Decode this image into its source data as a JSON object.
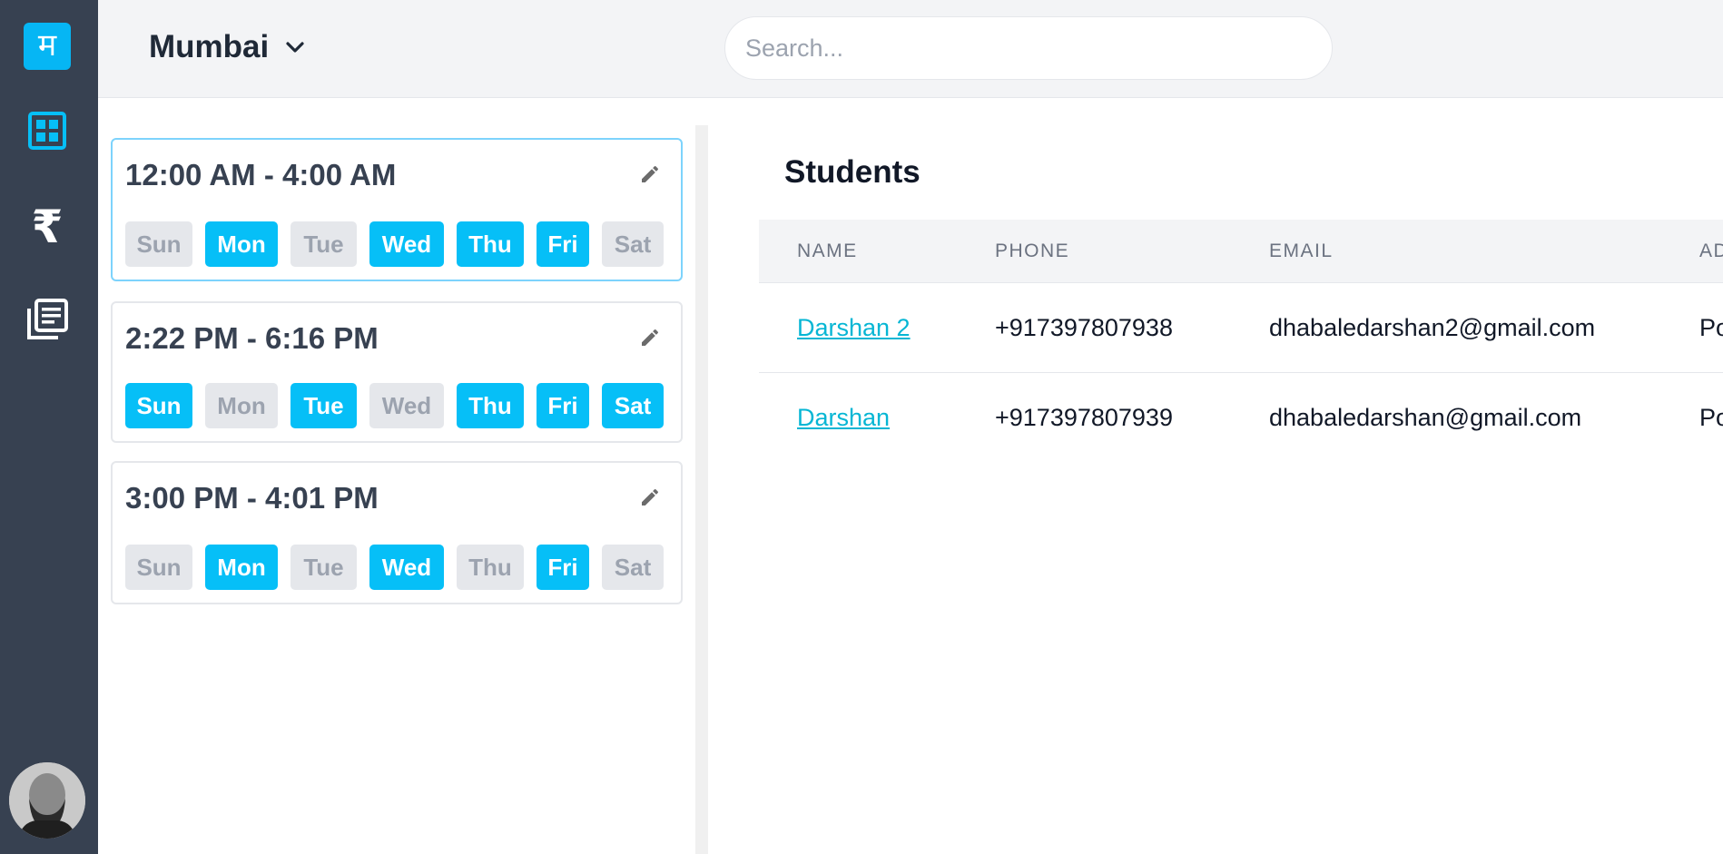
{
  "app": {
    "logo_glyph": "म",
    "accent_color": "#06bff7"
  },
  "sidebar": {
    "items": [
      {
        "icon": "dashboard-grid-icon"
      },
      {
        "icon": "rupee-icon",
        "glyph": "₹"
      },
      {
        "icon": "library-books-icon"
      }
    ],
    "avatar": "user-avatar"
  },
  "header": {
    "location": "Mumbai",
    "search_placeholder": "Search..."
  },
  "schedules": [
    {
      "time": "12:00 AM - 4:00 AM",
      "days": [
        {
          "label": "Sun",
          "active": false
        },
        {
          "label": "Mon",
          "active": true
        },
        {
          "label": "Tue",
          "active": false
        },
        {
          "label": "Wed",
          "active": true
        },
        {
          "label": "Thu",
          "active": true
        },
        {
          "label": "Fri",
          "active": true
        },
        {
          "label": "Sat",
          "active": false
        }
      ]
    },
    {
      "time": "2:22 PM - 6:16 PM",
      "days": [
        {
          "label": "Sun",
          "active": true
        },
        {
          "label": "Mon",
          "active": false
        },
        {
          "label": "Tue",
          "active": true
        },
        {
          "label": "Wed",
          "active": false
        },
        {
          "label": "Thu",
          "active": true
        },
        {
          "label": "Fri",
          "active": true
        },
        {
          "label": "Sat",
          "active": true
        }
      ]
    },
    {
      "time": "3:00 PM - 4:01 PM",
      "days": [
        {
          "label": "Sun",
          "active": false
        },
        {
          "label": "Mon",
          "active": true
        },
        {
          "label": "Tue",
          "active": false
        },
        {
          "label": "Wed",
          "active": true
        },
        {
          "label": "Thu",
          "active": false
        },
        {
          "label": "Fri",
          "active": true
        },
        {
          "label": "Sat",
          "active": false
        }
      ]
    }
  ],
  "students": {
    "title": "Students",
    "columns": [
      "NAME",
      "PHONE",
      "EMAIL",
      "AD"
    ],
    "rows": [
      {
        "name": "Darshan 2",
        "phone": "+917397807938",
        "email": "dhabaledarshan2@gmail.com",
        "address": "Po"
      },
      {
        "name": "Darshan",
        "phone": "+917397807939",
        "email": "dhabaledarshan@gmail.com",
        "address": "Po"
      }
    ]
  }
}
